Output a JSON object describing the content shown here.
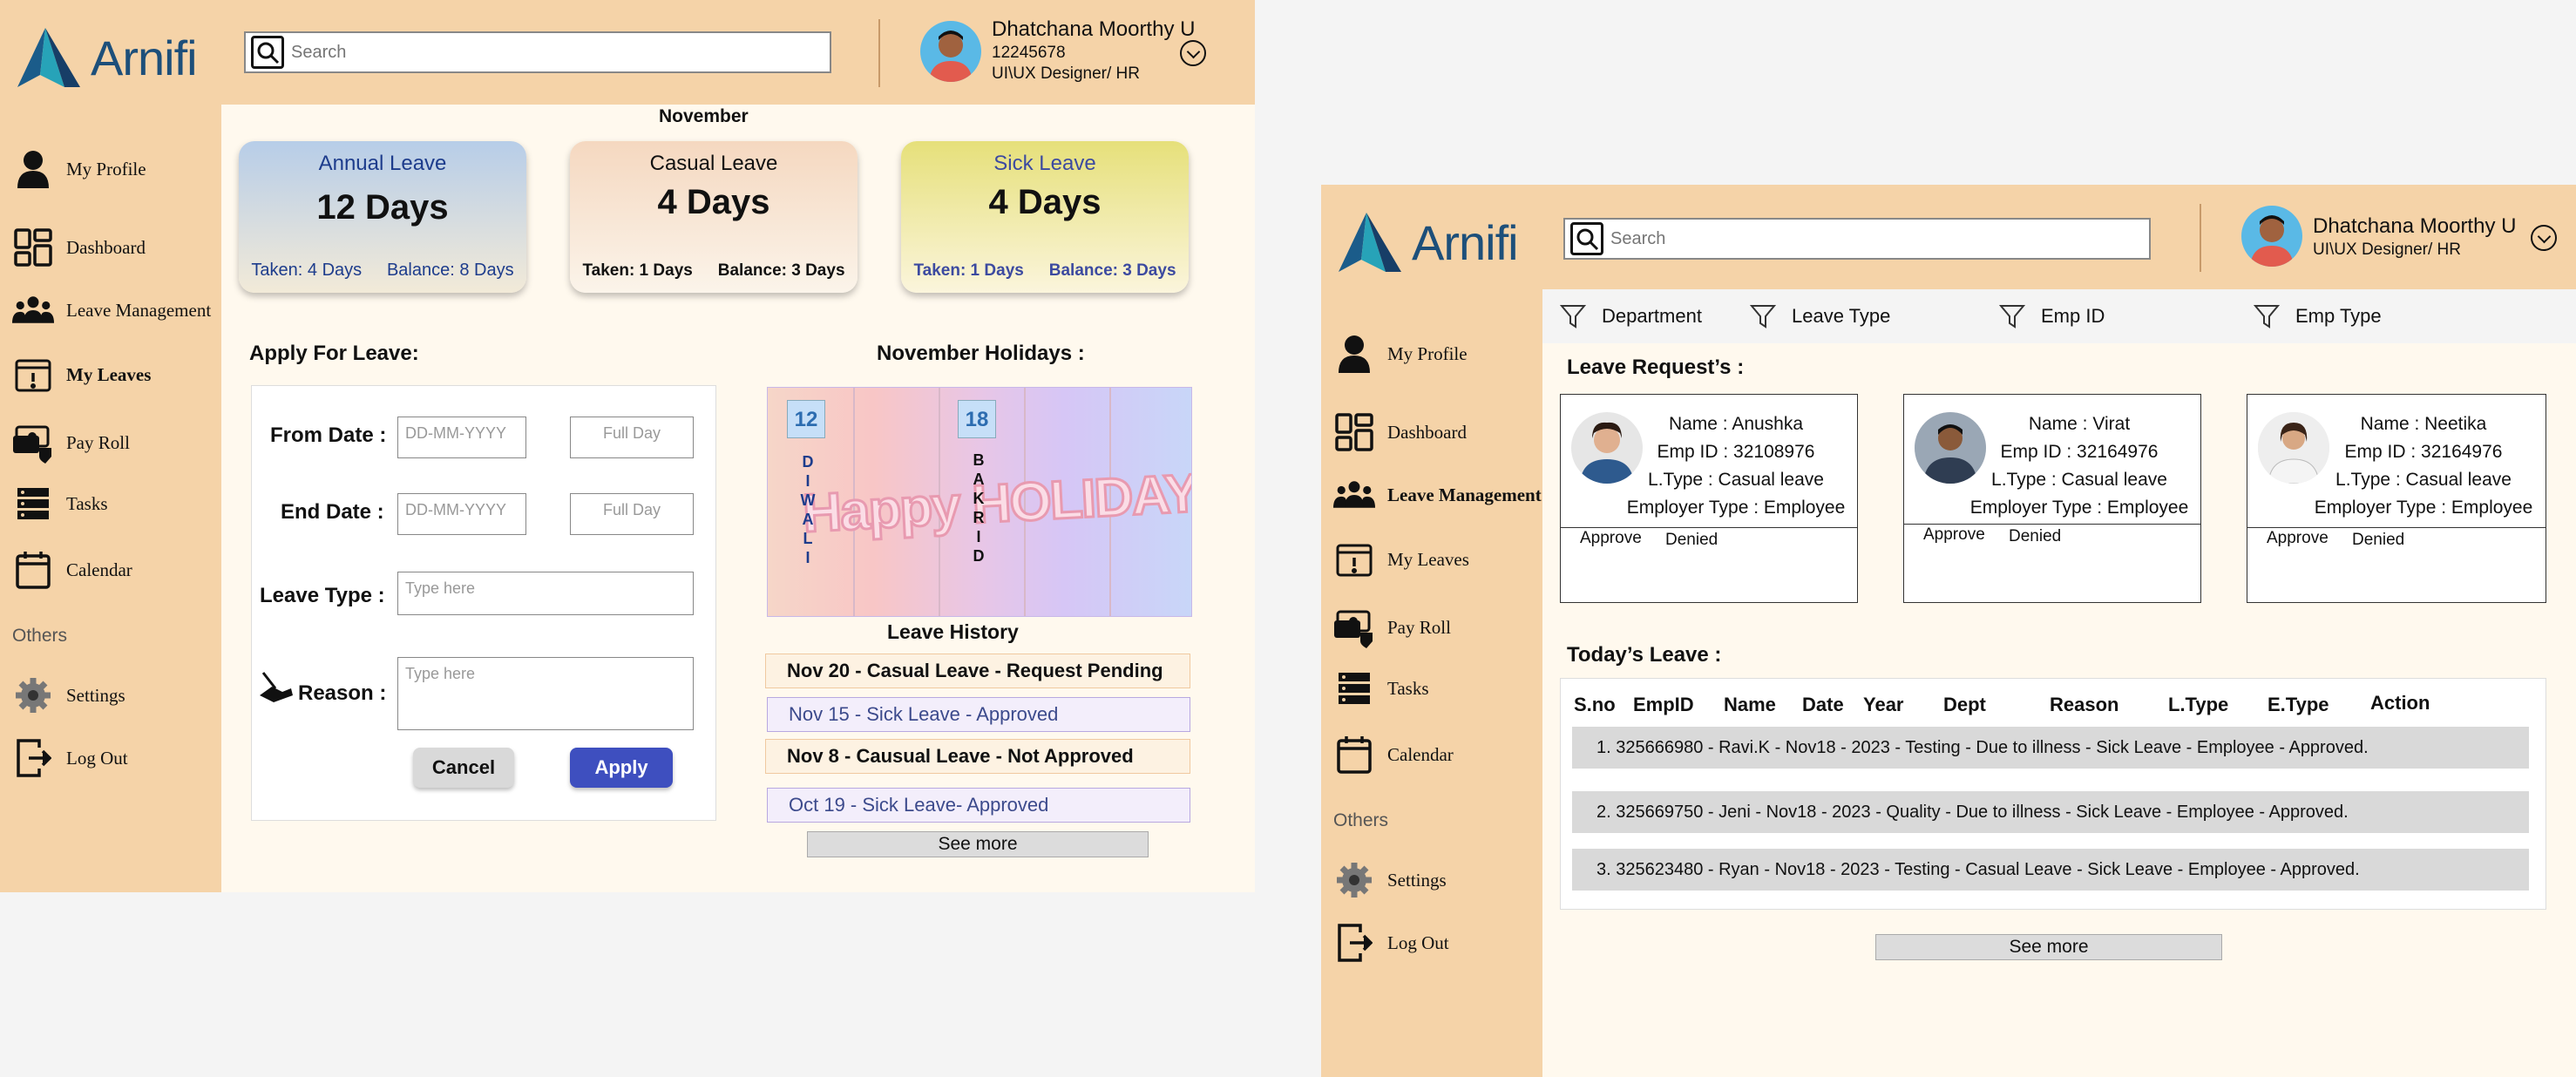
{
  "brand": {
    "name": "Arnifi"
  },
  "user": {
    "name": "Dhatchana Moorthy U",
    "id": "12245678",
    "role": "UI\\UX Designer/ HR"
  },
  "search": {
    "placeholder": "Search"
  },
  "sidebar": {
    "items": [
      {
        "label": "My Profile",
        "icon": "user-icon"
      },
      {
        "label": "Dashboard",
        "icon": "dashboard-icon"
      },
      {
        "label": "Leave Management",
        "icon": "team-icon"
      },
      {
        "label": "My Leaves",
        "icon": "calendar-alert-icon"
      },
      {
        "label": "Pay Roll",
        "icon": "payroll-icon"
      },
      {
        "label": "Tasks",
        "icon": "tasks-icon"
      },
      {
        "label": "Calendar",
        "icon": "calendar-icon"
      }
    ],
    "others_label": "Others",
    "others": [
      {
        "label": "Settings",
        "icon": "gear-icon"
      },
      {
        "label": "Log Out",
        "icon": "logout-icon"
      }
    ]
  },
  "leaves_screen": {
    "month": "November",
    "cards": [
      {
        "title": "Annual Leave",
        "days": "12 Days",
        "taken": "Taken: 4 Days",
        "balance": "Balance: 8 Days"
      },
      {
        "title": "Casual Leave",
        "days": "4 Days",
        "taken": "Taken: 1 Days",
        "balance": "Balance: 3 Days"
      },
      {
        "title": "Sick Leave",
        "days": "4 Days",
        "taken": "Taken: 1 Days",
        "balance": "Balance: 3 Days"
      }
    ],
    "apply": {
      "title": "Apply For Leave:",
      "from_label": "From Date :",
      "end_label": "End Date :",
      "type_label": "Leave Type :",
      "reason_label": "Reason :",
      "date_placeholder": "DD-MM-YYYY",
      "day_placeholder": "Full Day",
      "type_placeholder": "Type here",
      "reason_placeholder": "Type here",
      "cancel": "Cancel",
      "apply": "Apply"
    },
    "holidays": {
      "title": "November Holidays :",
      "items": [
        {
          "day": "12",
          "name": "D I W A L I"
        },
        {
          "day": "18",
          "name": "B A K R I D"
        }
      ],
      "banner": "Happy HOLIDAYS!"
    },
    "history": {
      "title": "Leave History",
      "items": [
        "Nov 20 -  Casual Leave - Request Pending",
        "Nov 15 - Sick Leave  - Approved",
        "Nov 8 - Causual Leave - Not Approved",
        "Oct 19 - Sick Leave- Approved"
      ],
      "see_more": "See more"
    }
  },
  "management_screen": {
    "filters": [
      "Department",
      "Leave Type",
      "Emp ID",
      "Emp Type"
    ],
    "requests_title": "Leave Request’s :",
    "requests": [
      {
        "name": "Name : Anushka",
        "emp_id": "Emp ID : 32108976",
        "ltype": "L.Type : Casual leave",
        "etype": "Employer Type : Employee",
        "approve": "Approve",
        "deny": "Denied"
      },
      {
        "name": "Name :  Virat",
        "emp_id": "Emp ID : 32164976",
        "ltype": "L.Type : Casual leave",
        "etype": "Employer Type : Employee",
        "approve": "Approve",
        "deny": "Denied"
      },
      {
        "name": "Name :  Neetika",
        "emp_id": "Emp ID : 32164976",
        "ltype": "L.Type : Casual leave",
        "etype": "Employer Type : Employee",
        "approve": "Approve",
        "deny": "Denied"
      }
    ],
    "today_title": "Today’s Leave :",
    "table_headers": [
      "S.no",
      "EmpID",
      "Name",
      "Date",
      "Year",
      "Dept",
      "Reason",
      "L.Type",
      "E.Type",
      "Action"
    ],
    "rows": [
      "1.  325666980 - Ravi.K - Nov18 - 2023 - Testing  - Due to illness - Sick Leave - Employee - Approved.",
      "2.  325669750 - Jeni - Nov18 - 2023 - Quality  - Due to illness - Sick Leave - Employee - Approved.",
      "3.  325623480 - Ryan - Nov18 - 2023 - Testing  - Casual Leave - Sick Leave - Employee - Approved."
    ],
    "see_more": "See more"
  }
}
